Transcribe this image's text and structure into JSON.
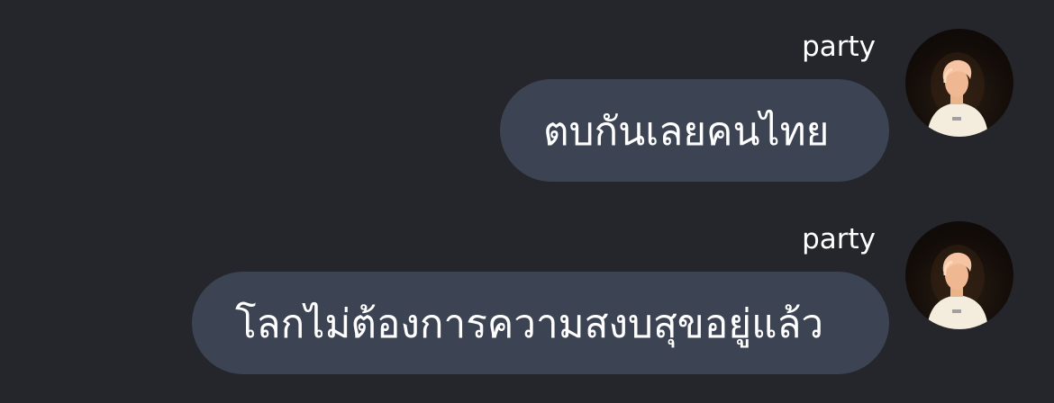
{
  "messages": [
    {
      "sender": "party",
      "text": "ตบกันเลยคนไทย"
    },
    {
      "sender": "party",
      "text": "โลกไม่ต้องการความสงบสุขอยู่แล้ว"
    }
  ],
  "colors": {
    "background": "#25262c",
    "bubble": "#3c4353",
    "text": "#ffffff"
  }
}
